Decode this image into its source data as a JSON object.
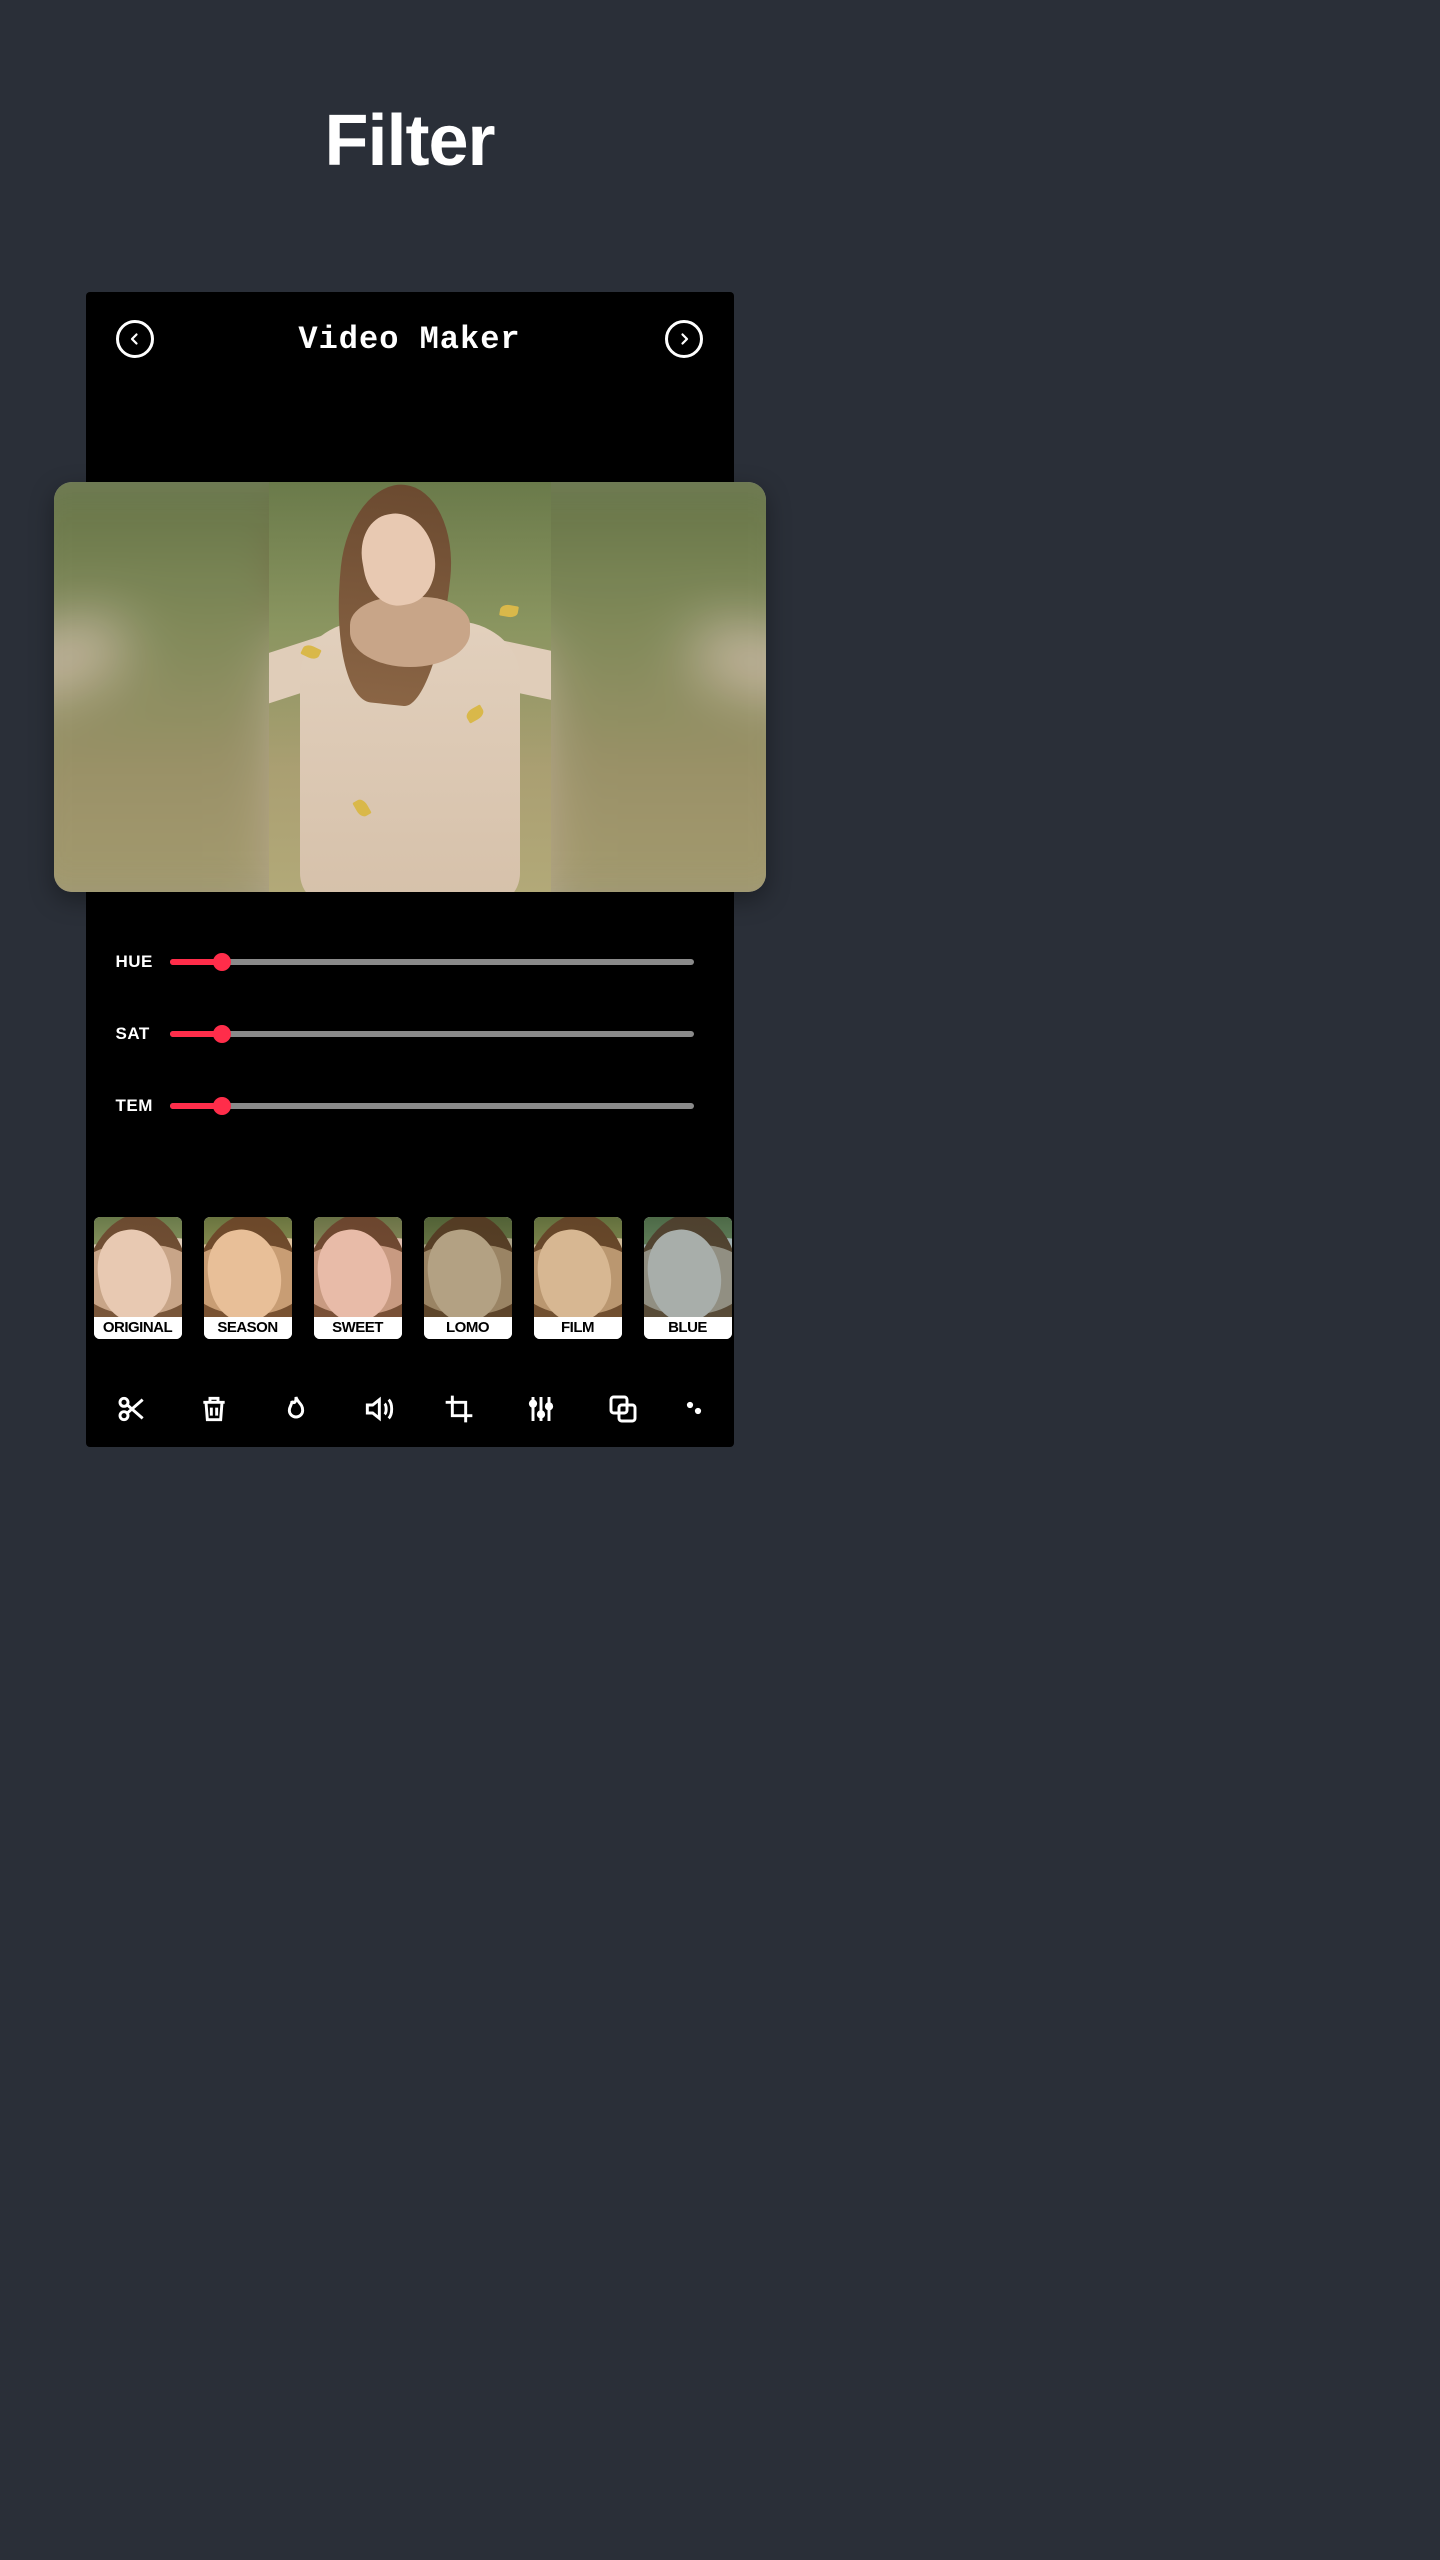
{
  "page": {
    "title": "Filter"
  },
  "app": {
    "title": "Video Maker",
    "icons": {
      "back": "arrow-left-circle",
      "forward": "arrow-right-circle"
    }
  },
  "sliders": [
    {
      "label": "HUE",
      "value": 10
    },
    {
      "label": "SAT",
      "value": 10
    },
    {
      "label": "TEM",
      "value": 10
    }
  ],
  "filters": [
    {
      "label": "ORIGINAL",
      "tint": ""
    },
    {
      "label": "SEASON",
      "tint": "t-season"
    },
    {
      "label": "SWEET",
      "tint": "t-sweet"
    },
    {
      "label": "LOMO",
      "tint": "t-lomo"
    },
    {
      "label": "FILM",
      "tint": "t-film"
    },
    {
      "label": "BLUE",
      "tint": "t-blue"
    }
  ],
  "toolbar": [
    {
      "name": "cut-icon"
    },
    {
      "name": "trash-icon"
    },
    {
      "name": "flame-icon"
    },
    {
      "name": "volume-icon"
    },
    {
      "name": "crop-icon"
    },
    {
      "name": "adjust-icon"
    },
    {
      "name": "overlay-icon"
    },
    {
      "name": "more-icon"
    }
  ]
}
